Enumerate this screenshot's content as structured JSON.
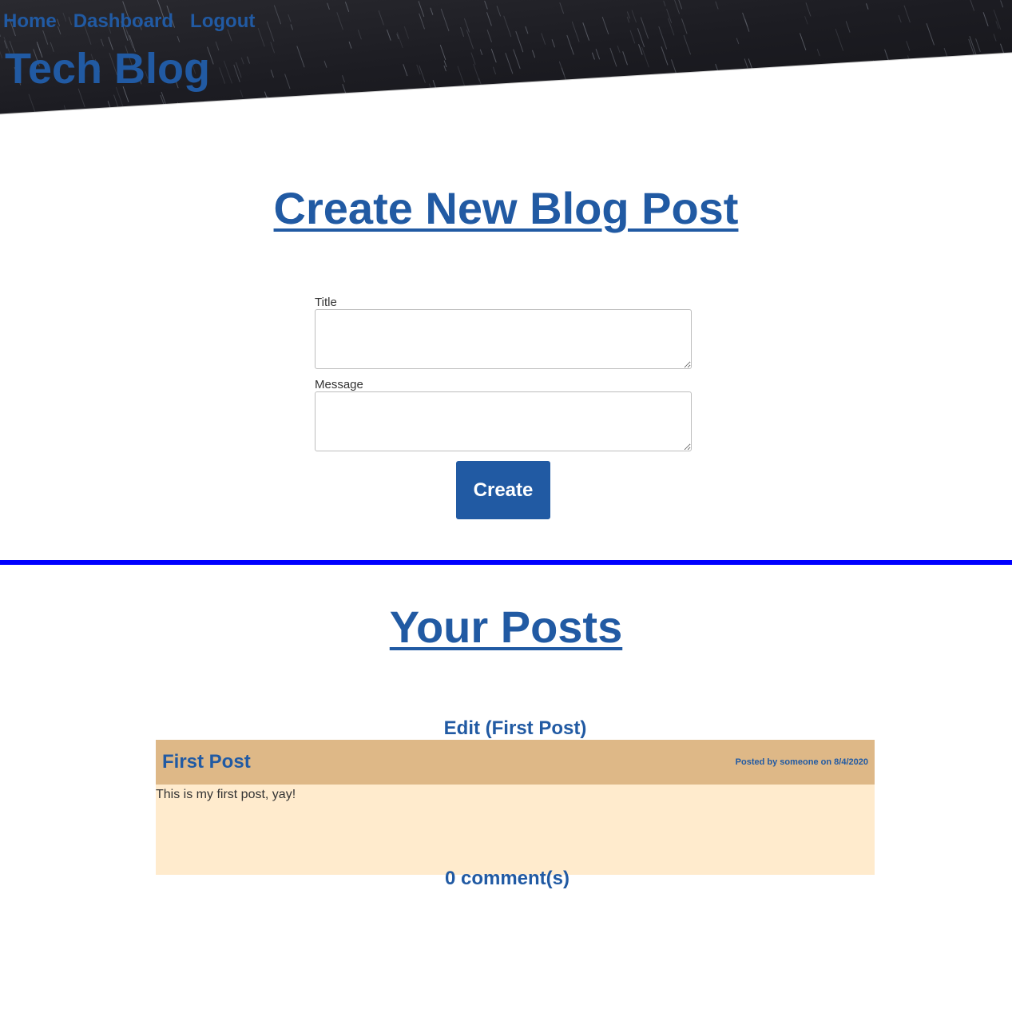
{
  "nav": {
    "home": "Home",
    "dashboard": "Dashboard",
    "logout": "Logout"
  },
  "site": {
    "title": "Tech Blog"
  },
  "create_section": {
    "heading": "Create New Blog Post",
    "title_label": "Title",
    "title_value": "",
    "message_label": "Message",
    "message_value": "",
    "submit_label": "Create"
  },
  "posts_section": {
    "heading": "Your Posts",
    "posts": [
      {
        "edit_label": "Edit (First Post)",
        "title": "First Post",
        "meta_prefix": "Posted by",
        "author": "someone",
        "meta_on": "on",
        "date": "8/4/2020",
        "body": "This is my first post, yay!",
        "comments_label": "0 comment(s)"
      }
    ]
  },
  "colors": {
    "link_blue": "#215aa3",
    "divider_blue": "#0000ff",
    "post_header_bg": "#deb887",
    "post_body_bg": "#ffebcd",
    "header_dark": "#1c1c22"
  }
}
